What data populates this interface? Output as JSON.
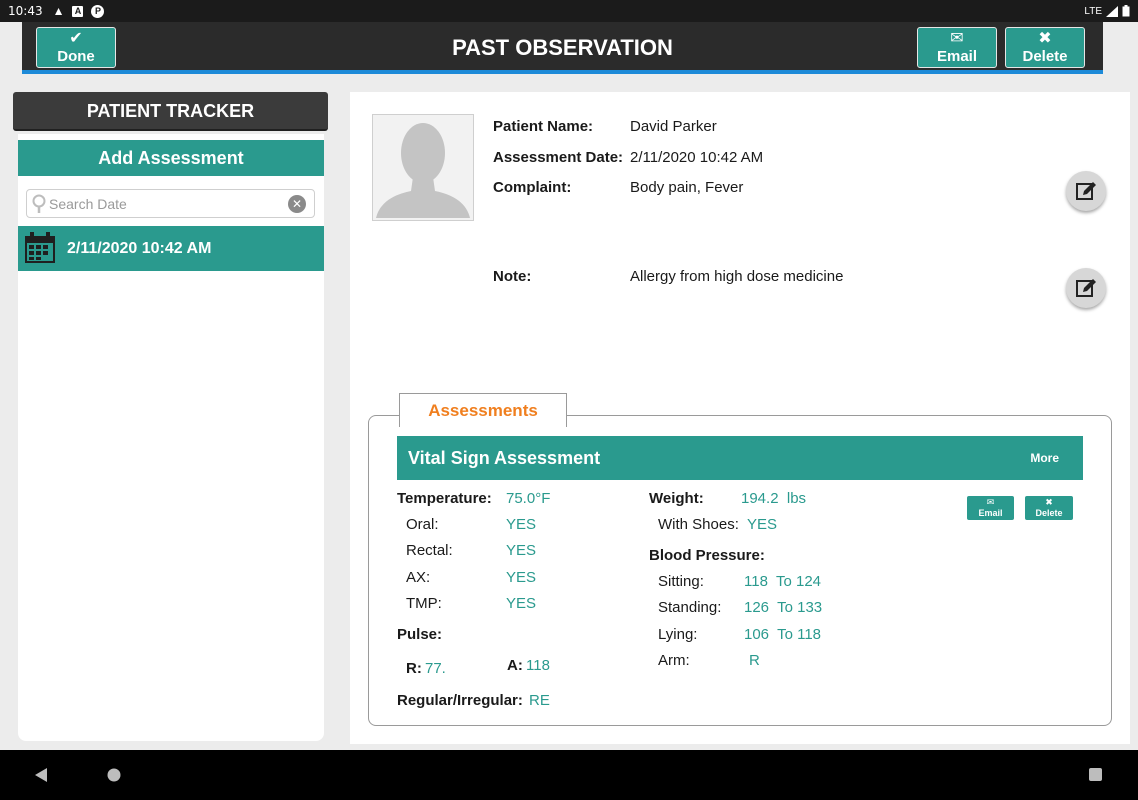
{
  "status_bar": {
    "time": "10:43",
    "network": "LTE"
  },
  "app_bar": {
    "title": "PAST OBSERVATION",
    "done_label": "Done",
    "email_label": "Email",
    "delete_label": "Delete"
  },
  "sidebar": {
    "header": "PATIENT TRACKER",
    "add_label": "Add Assessment",
    "search_placeholder": "Search Date",
    "search_value": "",
    "items": [
      {
        "label": "2/11/2020 10:42 AM"
      }
    ]
  },
  "patient": {
    "name_label": "Patient Name:",
    "name": "David Parker",
    "date_label": "Assessment Date:",
    "date": "2/11/2020 10:42 AM",
    "complaint_label": "Complaint:",
    "complaint": "Body pain, Fever",
    "note_label": "Note:",
    "note": "Allergy from high dose medicine"
  },
  "assessments": {
    "tab_label": "Assessments",
    "card": {
      "title": "Vital Sign Assessment",
      "more_label": "More",
      "email_label": "Email",
      "delete_label": "Delete",
      "temperature_label": "Temperature:",
      "temperature": "75.0°F",
      "oral_label": "Oral:",
      "oral": "YES",
      "rectal_label": "Rectal:",
      "rectal": "YES",
      "ax_label": "AX:",
      "ax": "YES",
      "tmp_label": "TMP:",
      "tmp": "YES",
      "pulse_label": "Pulse:",
      "r_label": "R:",
      "r": "77.",
      "a_label": "A:",
      "a": "118",
      "regular_label": "Regular/Irregular:",
      "regular": "RE",
      "weight_label": "Weight:",
      "weight": "194.2  lbs",
      "shoes_label": "With Shoes:",
      "shoes": "YES",
      "bp_label": "Blood Pressure:",
      "sitting_label": "Sitting:",
      "sitting": "118  To 124",
      "standing_label": "Standing:",
      "standing": "126  To 133",
      "lying_label": "Lying:",
      "lying": "106  To 118",
      "arm_label": "Arm:",
      "arm": "R"
    }
  },
  "colors": {
    "teal": "#2a9a8e",
    "dark_bar": "#2b2b2b",
    "accent_blue": "#1d8ad8",
    "orange": "#f07f1f"
  }
}
